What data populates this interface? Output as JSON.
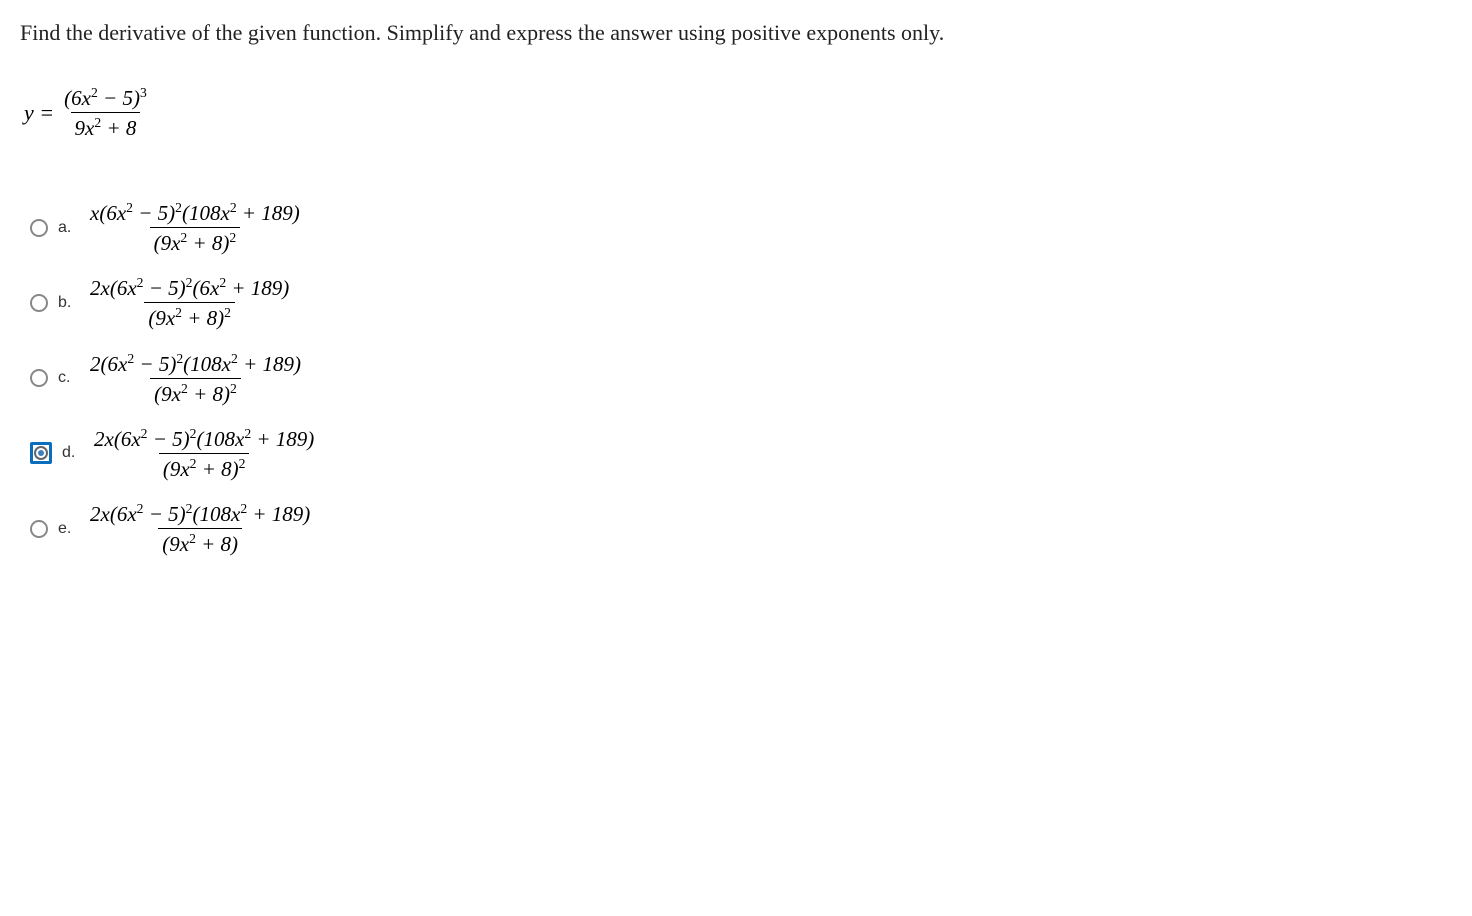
{
  "question": {
    "prompt": "Find the derivative of the given function. Simplify and express the answer using positive exponents only.",
    "y_label": "y =",
    "func_num": "(6x² − 5)³",
    "func_den": "9x² + 8"
  },
  "options": {
    "a": {
      "label": "a.",
      "num": "x(6x² − 5)²(108x² + 189)",
      "den": "(9x² + 8)²",
      "selected": false
    },
    "b": {
      "label": "b.",
      "num": "2x(6x² − 5)²(6x² + 189)",
      "den": "(9x² + 8)²",
      "selected": false
    },
    "c": {
      "label": "c.",
      "num": "2(6x² − 5)²(108x² + 189)",
      "den": "(9x² + 8)²",
      "selected": false
    },
    "d": {
      "label": "d.",
      "num": "2x(6x² − 5)²(108x² + 189)",
      "den": "(9x² + 8)²",
      "selected": true
    },
    "e": {
      "label": "e.",
      "num": "2x(6x² − 5)²(108x² + 189)",
      "den": "(9x² + 8)",
      "selected": false
    }
  }
}
